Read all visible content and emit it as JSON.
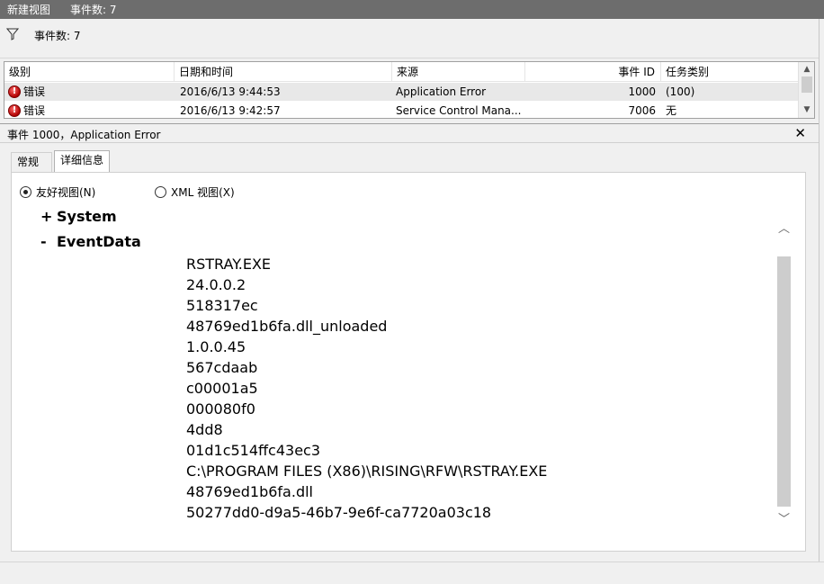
{
  "titlebar": {
    "view_name": "新建视图",
    "event_count": "事件数: 7"
  },
  "filterbar": {
    "icon": "filter-icon",
    "event_count": "事件数: 7"
  },
  "table": {
    "headers": {
      "level": "级别",
      "datetime": "日期和时间",
      "source": "来源",
      "event_id": "事件 ID",
      "task_category": "任务类别"
    },
    "rows": [
      {
        "level": "错误",
        "datetime": "2016/6/13 9:44:53",
        "source": "Application Error",
        "event_id": "1000",
        "task_category": "(100)",
        "icon": "error-icon"
      },
      {
        "level": "错误",
        "datetime": "2016/6/13 9:42:57",
        "source": "Service Control Mana...",
        "event_id": "7006",
        "task_category": "无",
        "icon": "error-icon"
      }
    ]
  },
  "detail": {
    "title": "事件 1000，Application Error",
    "close_label": "✕",
    "tabs": [
      {
        "label": "常规"
      },
      {
        "label": "详细信息"
      }
    ],
    "view_options": {
      "friendly": "友好视图(N)",
      "xml": "XML 视图(X)",
      "selected": "friendly"
    },
    "tree": {
      "system": {
        "sign": "+",
        "label": "System"
      },
      "eventdata": {
        "sign": "-",
        "label": "EventData"
      }
    },
    "event_data": [
      "RSTRAY.EXE",
      "24.0.0.2",
      "518317ec",
      "48769ed1b6fa.dll_unloaded",
      "1.0.0.45",
      "567cdaab",
      "c00001a5",
      "000080f0",
      "4dd8",
      "01d1c514ffc43ec3",
      "C:\\PROGRAM FILES (X86)\\RISING\\RFW\\RSTRAY.EXE",
      "48769ed1b6fa.dll",
      "50277dd0-d9a5-46b7-9e6f-ca7720a03c18"
    ]
  },
  "colors": {
    "titlebar": "#6d6d6d",
    "error": "#c00000",
    "selected_row": "#e8e8e8"
  }
}
